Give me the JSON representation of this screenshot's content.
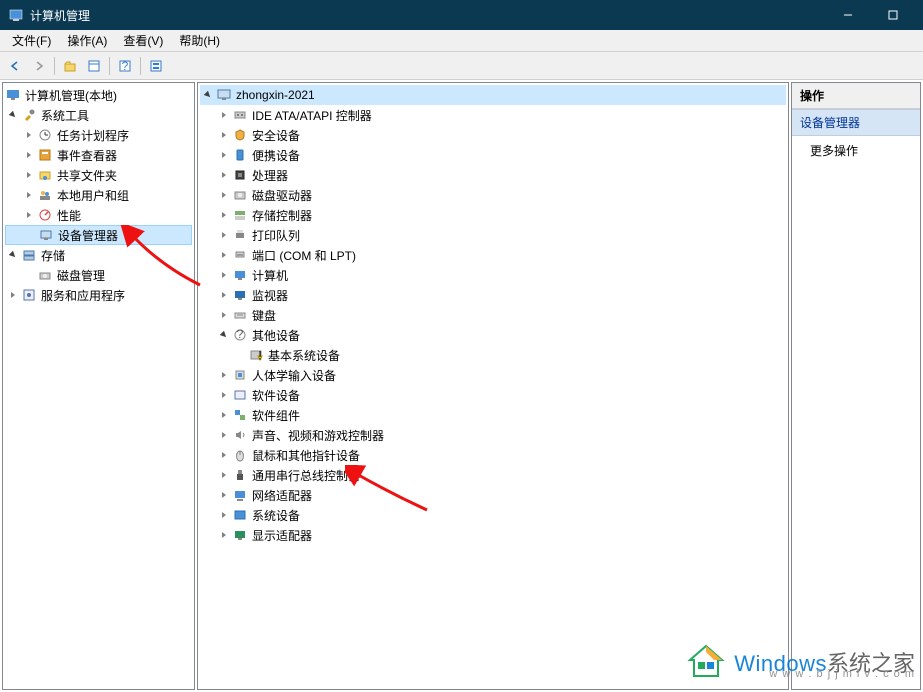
{
  "window": {
    "title": "计算机管理"
  },
  "menu": {
    "file": "文件(F)",
    "action": "操作(A)",
    "view": "查看(V)",
    "help": "帮助(H)"
  },
  "left_tree": {
    "root": "计算机管理(本地)",
    "system_tools": "系统工具",
    "task_scheduler": "任务计划程序",
    "event_viewer": "事件查看器",
    "shared_folders": "共享文件夹",
    "local_users": "本地用户和组",
    "performance": "性能",
    "device_manager": "设备管理器",
    "storage": "存储",
    "disk_management": "磁盘管理",
    "services_apps": "服务和应用程序"
  },
  "center_tree": {
    "root": "zhongxin-2021",
    "ide": "IDE ATA/ATAPI 控制器",
    "security": "安全设备",
    "portable": "便携设备",
    "processors": "处理器",
    "disk_drives": "磁盘驱动器",
    "storage_ctrl": "存储控制器",
    "print_queues": "打印队列",
    "ports": "端口 (COM 和 LPT)",
    "computer": "计算机",
    "monitors": "监视器",
    "keyboards": "键盘",
    "other_devices": "其他设备",
    "base_system": "基本系统设备",
    "hid": "人体学输入设备",
    "soft_devices": "软件设备",
    "soft_components": "软件组件",
    "sound": "声音、视频和游戏控制器",
    "mice": "鼠标和其他指针设备",
    "usb": "通用串行总线控制器",
    "network": "网络适配器",
    "system_devices": "系统设备",
    "display": "显示适配器"
  },
  "right_panel": {
    "header": "操作",
    "section": "设备管理器",
    "more": "更多操作"
  },
  "watermark": {
    "brand": "Windows",
    "suffix": "系统之家",
    "url": "w w w . b j j m l v . c o m"
  }
}
